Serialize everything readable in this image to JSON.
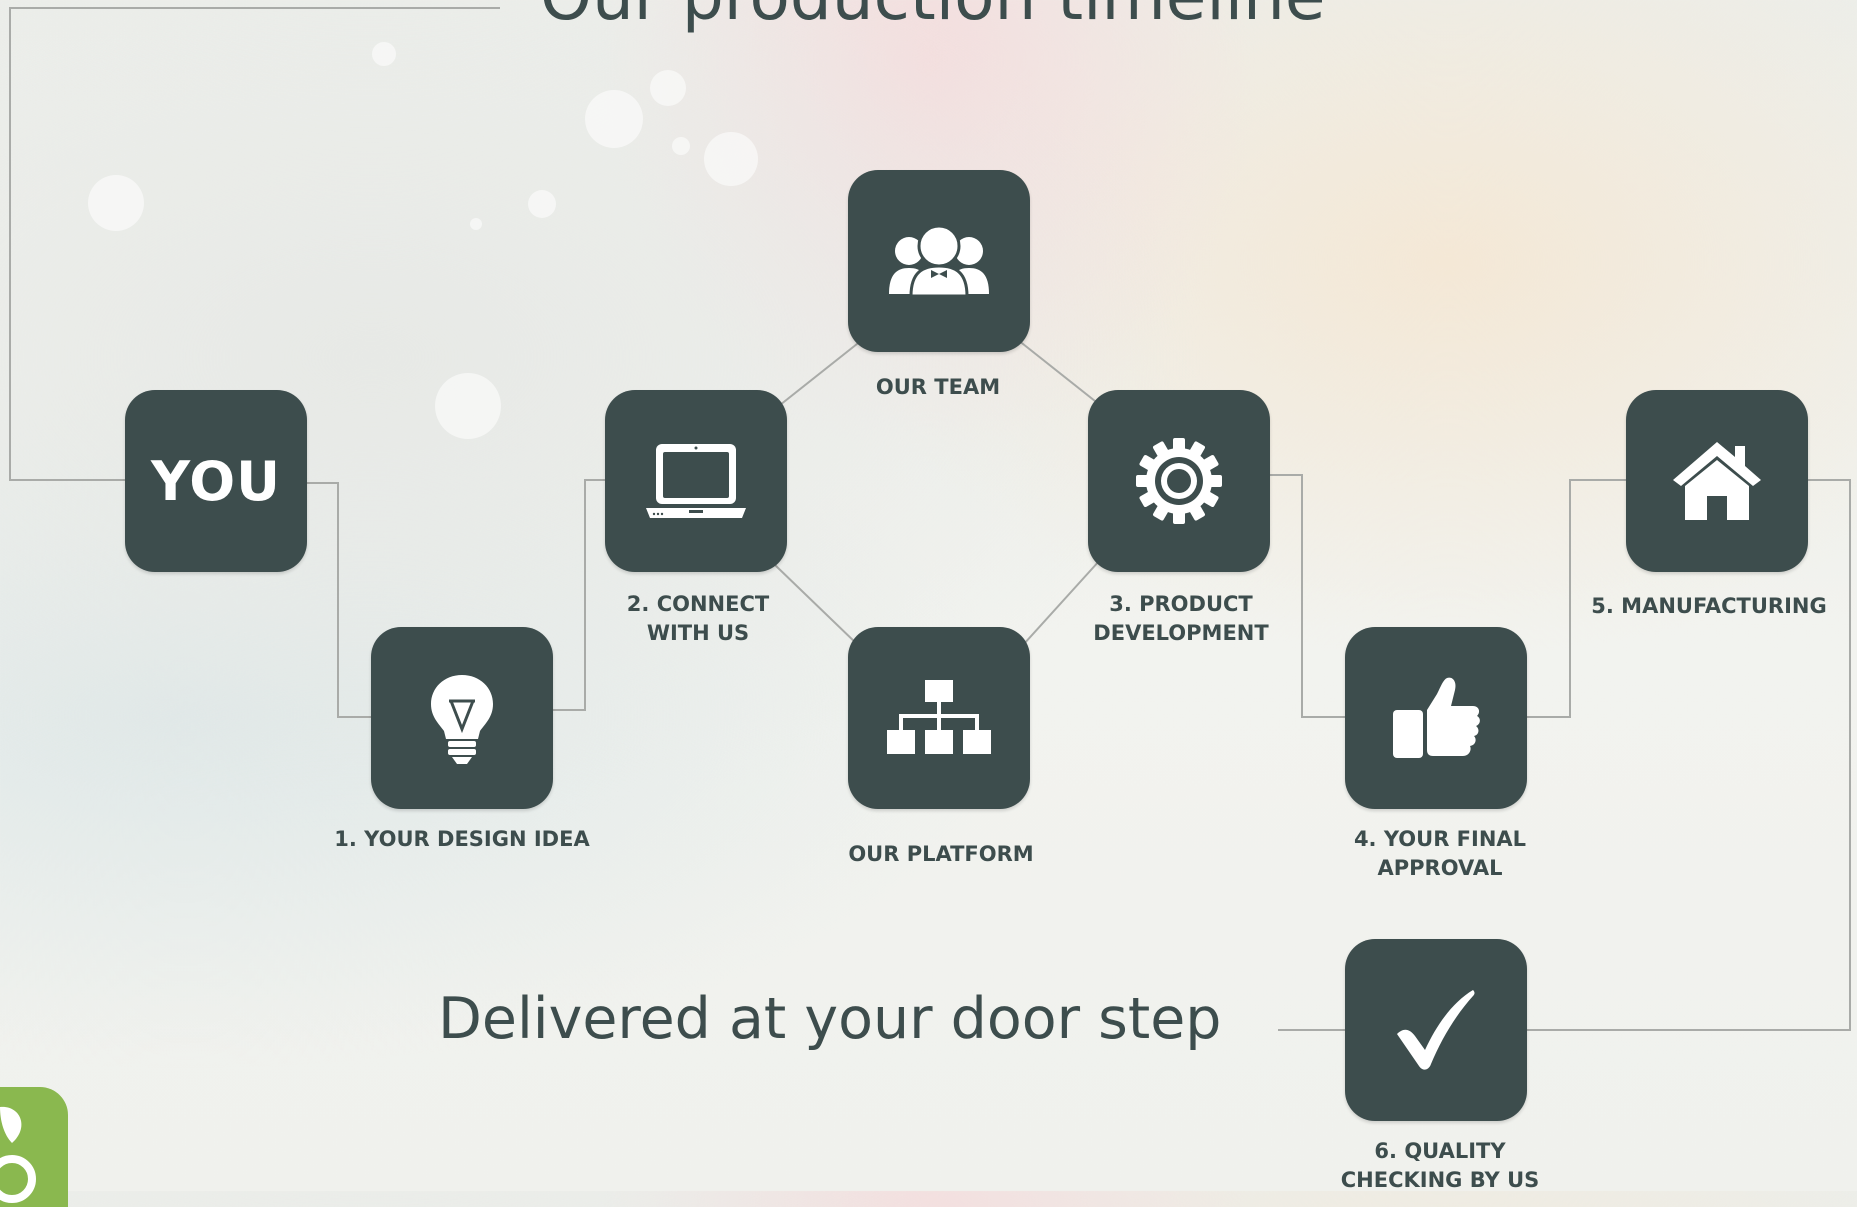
{
  "title": "Our production timeline",
  "footer_title": "Delivered at your door step",
  "you_label": "YOU",
  "steps": {
    "design": {
      "label": "1. YOUR DESIGN IDEA",
      "icon": "lightbulb-icon"
    },
    "connect": {
      "label_line1": "2. CONNECT",
      "label_line2": "WITH US",
      "icon": "laptop-icon"
    },
    "team": {
      "label": "OUR TEAM",
      "icon": "team-icon"
    },
    "platform": {
      "label": "OUR PLATFORM",
      "icon": "sitemap-icon"
    },
    "development": {
      "label_line1": "3. PRODUCT",
      "label_line2": "DEVELOPMENT",
      "icon": "gear-icon"
    },
    "approval": {
      "label_line1": "4. YOUR FINAL",
      "label_line2": "APPROVAL",
      "icon": "thumbs-up-icon"
    },
    "manufacturing": {
      "label": "5. MANUFACTURING",
      "icon": "house-icon"
    },
    "quality": {
      "label_line1": "6. QUALITY",
      "label_line2": "CHECKING BY US",
      "icon": "checkmark-icon"
    }
  },
  "colors": {
    "tile": "#3d4d4d",
    "text": "#3d4d4d",
    "connector": "#a9aba8",
    "badge": "#8ab84f"
  }
}
